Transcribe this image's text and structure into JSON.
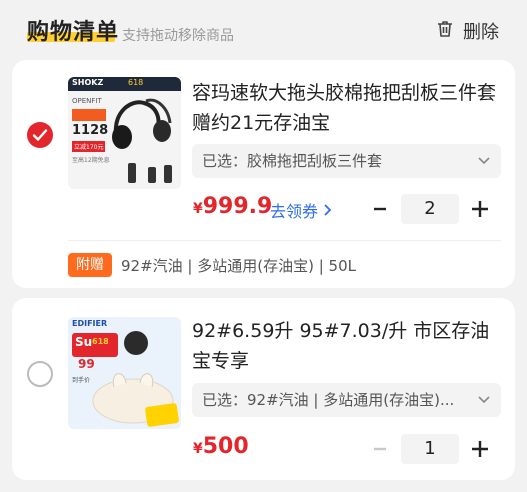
{
  "header": {
    "title": "购物清单",
    "subtitle": "支持拖动移除商品",
    "delete_label": "删除",
    "highlight_color": "#ffcf33"
  },
  "items": [
    {
      "checked": true,
      "thumb": {
        "brand": "SHOKZ",
        "badge": "618",
        "tag": "OPENFIT",
        "price": "1128",
        "promo": "立减170元",
        "note": "至高12期免息"
      },
      "name": "容玛速软大拖头胶棉拖把刮板三件套赠约21元存油宝",
      "variant": "已选：胶棉拖把刮板三件套",
      "currency": "¥",
      "price": "999.9",
      "coupon": "去领券",
      "quantity": "2",
      "gift_tag": "附赠",
      "gift_text": "92#汽油 | 多站通用(存油宝) | 50L"
    },
    {
      "checked": false,
      "thumb": {
        "brand": "EDIFIER",
        "tag": "Su",
        "promo": "618",
        "price": "99",
        "note": "到手价"
      },
      "name": "92#6.59升 95#7.03/升 市区存油宝专享",
      "variant": "已选：92#汽油 | 多站通用(存油宝)...",
      "currency": "¥",
      "price": "500",
      "quantity": "1"
    }
  ],
  "colors": {
    "accent": "#e2262c",
    "link": "#2f6ee8",
    "gift": "#ff6a1f"
  }
}
